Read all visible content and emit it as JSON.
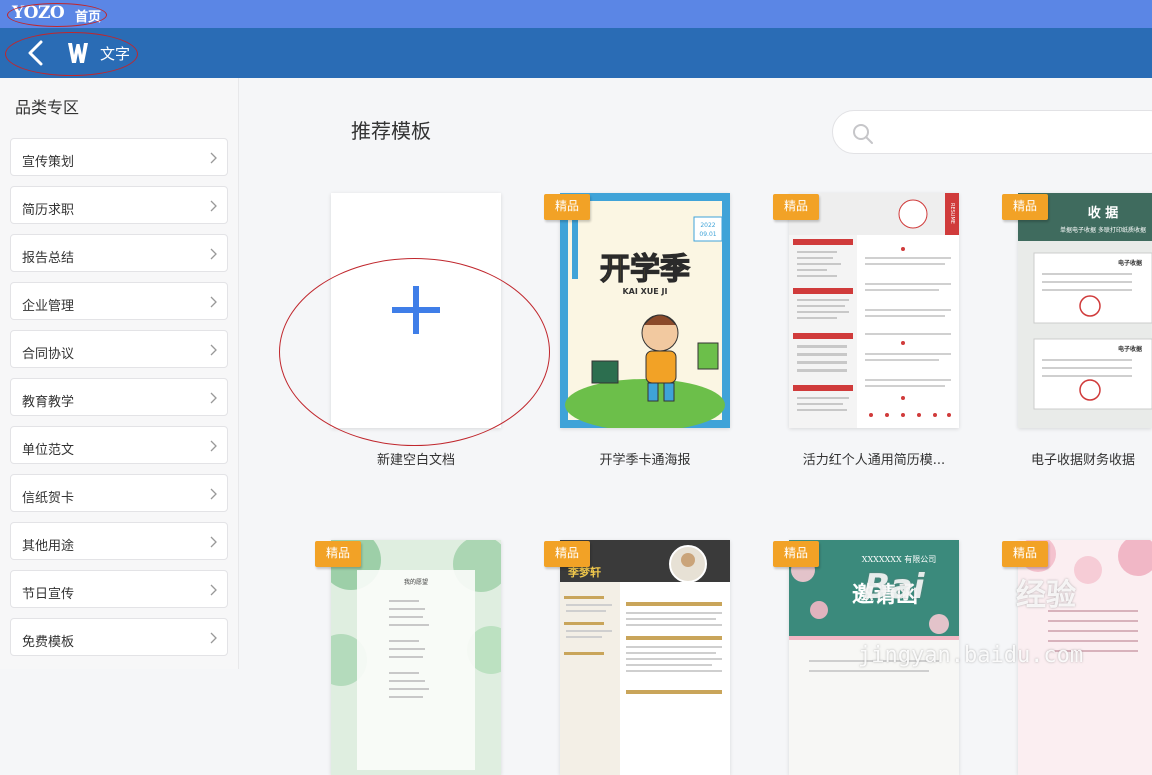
{
  "topbar": {
    "brand": "YOZO",
    "home": "首页"
  },
  "header": {
    "back_icon": "chevron-left-icon",
    "app_icon": "w-logo-icon",
    "title": "文字"
  },
  "sidebar": {
    "title": "品类专区",
    "items": [
      {
        "label": "宣传策划"
      },
      {
        "label": "简历求职"
      },
      {
        "label": "报告总结"
      },
      {
        "label": "企业管理"
      },
      {
        "label": "合同协议"
      },
      {
        "label": "教育教学"
      },
      {
        "label": "单位范文"
      },
      {
        "label": "信纸贺卡"
      },
      {
        "label": "其他用途"
      },
      {
        "label": "节日宣传"
      },
      {
        "label": "免费模板"
      }
    ]
  },
  "main": {
    "section_title": "推荐模板",
    "search_icon": "search-icon",
    "badge_label": "精品",
    "cards": [
      {
        "label": "新建空白文档"
      },
      {
        "label": "开学季卡通海报",
        "poster_title": "开学季",
        "poster_pinyin": "KAI XUE JI",
        "poster_year": "2022",
        "poster_date": "09.01"
      },
      {
        "label": "活力红个人通用简历模...",
        "resume_side": "RESUME"
      },
      {
        "label": "电子收据财务收据",
        "receipt_title": "收 据",
        "receipt_sub": "单据电子收据 多联打印纸质收据",
        "receipt_doc": "电子收据"
      },
      {
        "label": "",
        "note_title": "我的愿望"
      },
      {
        "label": "",
        "cv_name": "李梦轩"
      },
      {
        "label": "",
        "invite_company": "XXXXXXX 有限公司",
        "invite_title": "邀请函"
      },
      {
        "label": ""
      }
    ]
  },
  "watermark": {
    "brand": "Bai",
    "text": "经验",
    "sub": "jingyan.baidu.com"
  },
  "colors": {
    "topbar": "#5b86e5",
    "header": "#2a6cb5",
    "badge": "#f2a226",
    "plus": "#3f7ee8",
    "annotation": "#c0272d"
  }
}
